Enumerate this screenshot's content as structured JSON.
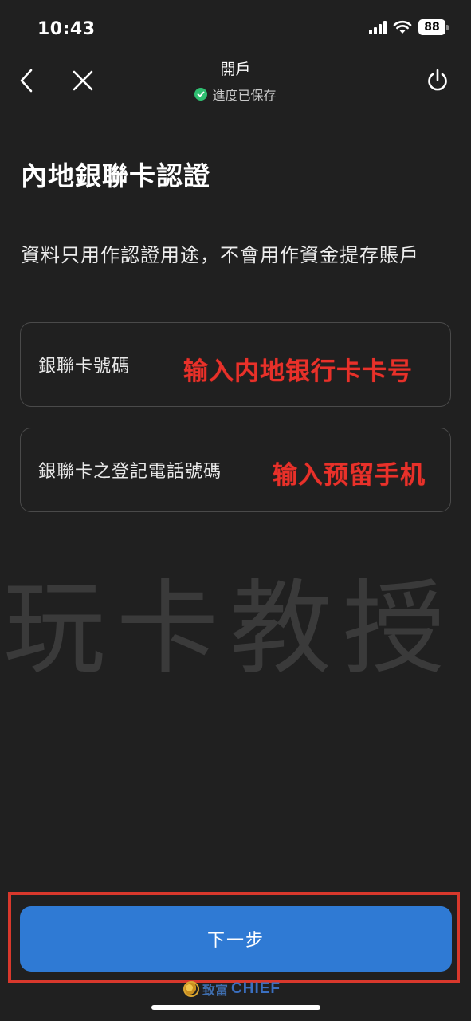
{
  "status_bar": {
    "time": "10:43",
    "battery": "88"
  },
  "nav": {
    "title": "開戶",
    "subtitle": "進度已保存"
  },
  "page": {
    "title": "內地銀聯卡認證",
    "description": "資料只用作認證用途，不會用作資金提存賬戶"
  },
  "fields": [
    {
      "label": "銀聯卡號碼",
      "annotation": "输入内地银行卡卡号"
    },
    {
      "label": "銀聯卡之登記電話號碼",
      "annotation": "输入预留手机"
    }
  ],
  "watermark": "玩卡教授",
  "actions": {
    "next_label": "下一步"
  },
  "footer": {
    "logo_cn": "致富",
    "logo_en": "CHIEF"
  },
  "colors": {
    "accent": "#2f7ad4",
    "annotation": "#e8312a",
    "success": "#2fbf71"
  }
}
